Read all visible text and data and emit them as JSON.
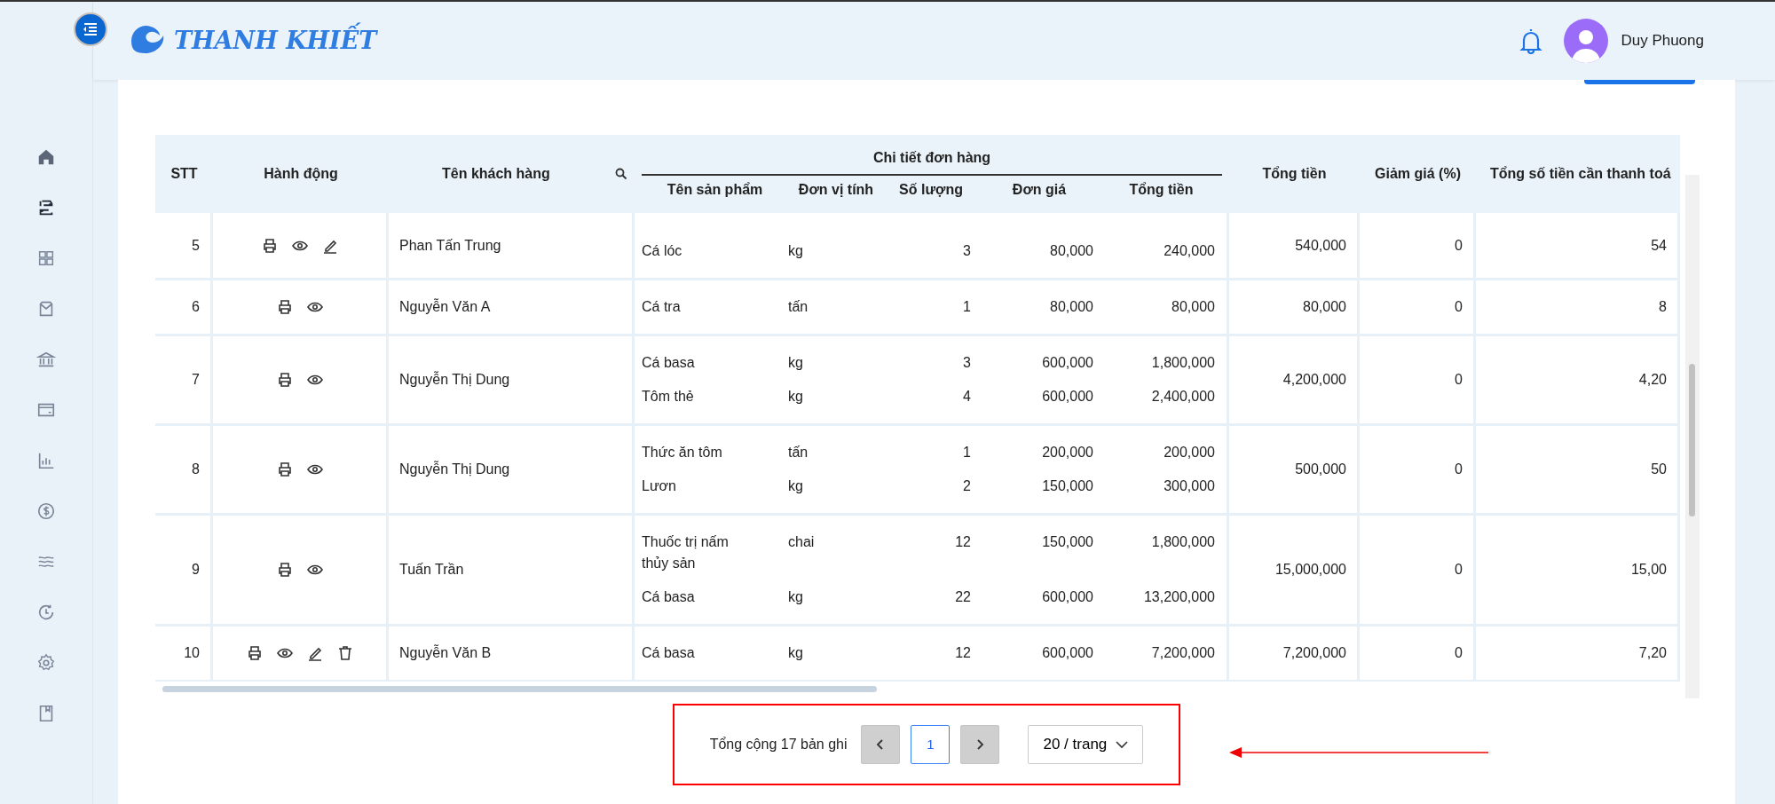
{
  "header": {
    "brand": "THANH KHIẾT",
    "user_name": "Duy Phuong"
  },
  "sidebar": {
    "items": [
      {
        "kind": "home",
        "selected": false
      },
      {
        "kind": "orders",
        "selected": true
      },
      {
        "kind": "grid",
        "selected": false
      },
      {
        "kind": "box",
        "selected": false
      },
      {
        "kind": "bank",
        "selected": false
      },
      {
        "kind": "card",
        "selected": false
      },
      {
        "kind": "chart",
        "selected": false
      },
      {
        "kind": "dollar",
        "selected": false
      },
      {
        "kind": "waves",
        "selected": false
      },
      {
        "kind": "history",
        "selected": false
      },
      {
        "kind": "settings",
        "selected": false
      },
      {
        "kind": "book",
        "selected": false
      }
    ]
  },
  "table": {
    "columns": {
      "stt": "STT",
      "actions": "Hành động",
      "customer": "Tên khách hàng",
      "details_title": "Chi tiết đơn hàng",
      "details": [
        "Tên sản phẩm",
        "Đơn vị tính",
        "Số lượng",
        "Đơn giá",
        "Tổng tiền"
      ],
      "total": "Tổng tiền",
      "discount": "Giảm giá (%)",
      "payable": "Tổng số tiền cần thanh toá"
    },
    "rows": [
      {
        "stt": "5",
        "actions": [
          {
            "kind": "print"
          },
          {
            "kind": "view"
          },
          {
            "kind": "edit"
          }
        ],
        "customer": "Phan Tấn Trung",
        "products": [
          {
            "name": "Cá lóc",
            "unit": "kg",
            "qty": "3",
            "price": "80,000",
            "total": "240,000"
          }
        ],
        "total": "540,000",
        "discount": "0",
        "payable": "54"
      },
      {
        "stt": "6",
        "actions": [
          {
            "kind": "print"
          },
          {
            "kind": "view"
          }
        ],
        "customer": "Nguyễn Văn A",
        "products": [
          {
            "name": "Cá tra",
            "unit": "tấn",
            "qty": "1",
            "price": "80,000",
            "total": "80,000"
          }
        ],
        "total": "80,000",
        "discount": "0",
        "payable": "8"
      },
      {
        "stt": "7",
        "actions": [
          {
            "kind": "print"
          },
          {
            "kind": "view"
          }
        ],
        "customer": "Nguyễn Thị Dung",
        "products": [
          {
            "name": "Cá basa",
            "unit": "kg",
            "qty": "3",
            "price": "600,000",
            "total": "1,800,000"
          },
          {
            "name": "Tôm thẻ",
            "unit": "kg",
            "qty": "4",
            "price": "600,000",
            "total": "2,400,000"
          }
        ],
        "total": "4,200,000",
        "discount": "0",
        "payable": "4,20"
      },
      {
        "stt": "8",
        "actions": [
          {
            "kind": "print"
          },
          {
            "kind": "view"
          }
        ],
        "customer": "Nguyễn Thị Dung",
        "products": [
          {
            "name": "Thức ăn tôm",
            "unit": "tấn",
            "qty": "1",
            "price": "200,000",
            "total": "200,000"
          },
          {
            "name": "Lươn",
            "unit": "kg",
            "qty": "2",
            "price": "150,000",
            "total": "300,000"
          }
        ],
        "total": "500,000",
        "discount": "0",
        "payable": "50"
      },
      {
        "stt": "9",
        "actions": [
          {
            "kind": "print"
          },
          {
            "kind": "view"
          }
        ],
        "customer": "Tuấn Trần",
        "products": [
          {
            "name": "Thuốc trị nấm thủy sản",
            "unit": "chai",
            "qty": "12",
            "price": "150,000",
            "total": "1,800,000"
          },
          {
            "name": "Cá basa",
            "unit": "kg",
            "qty": "22",
            "price": "600,000",
            "total": "13,200,000"
          }
        ],
        "total": "15,000,000",
        "discount": "0",
        "payable": "15,00"
      },
      {
        "stt": "10",
        "actions": [
          {
            "kind": "print"
          },
          {
            "kind": "view"
          },
          {
            "kind": "edit"
          },
          {
            "kind": "delete"
          }
        ],
        "customer": "Nguyễn Văn B",
        "products": [
          {
            "name": "Cá basa",
            "unit": "kg",
            "qty": "12",
            "price": "600,000",
            "total": "7,200,000"
          }
        ],
        "total": "7,200,000",
        "discount": "0",
        "payable": "7,20"
      }
    ]
  },
  "pagination": {
    "summary": "Tổng cộng 17 bản ghi",
    "pages": [
      {
        "label": "1",
        "selected": true
      }
    ],
    "page_size": "20 / trang"
  }
}
